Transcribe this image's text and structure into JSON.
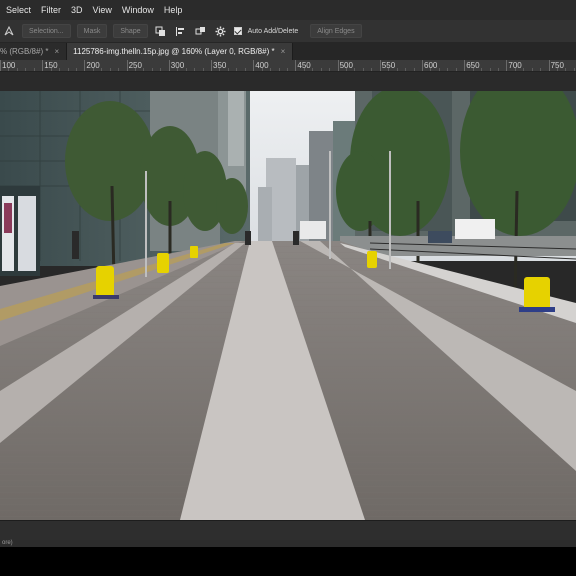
{
  "menu": [
    "Select",
    "Filter",
    "3D",
    "View",
    "Window",
    "Help"
  ],
  "options": {
    "selection_label": "Selection...",
    "mask_label": "Mask",
    "shape_label": "Shape",
    "auto_add_delete_label": "Auto Add/Delete",
    "align_edges_label": "Align Edges",
    "auto_add_delete_checked": true
  },
  "tabs": [
    {
      "label": "% (RGB/8#) *",
      "close": "×"
    },
    {
      "label": "1125786-img.thelln.15p.jpg @ 160% (Layer 0, RGB/8#) *",
      "close": "×"
    }
  ],
  "ruler": {
    "labels": [
      "100",
      "150",
      "200",
      "250",
      "300",
      "350",
      "400",
      "450",
      "500",
      "550",
      "600",
      "650",
      "700",
      "750"
    ]
  },
  "status": {
    "text": "ore)"
  },
  "colors": {
    "accent_yellow": "#e6d200",
    "app_bg": "#2b2b2b"
  }
}
